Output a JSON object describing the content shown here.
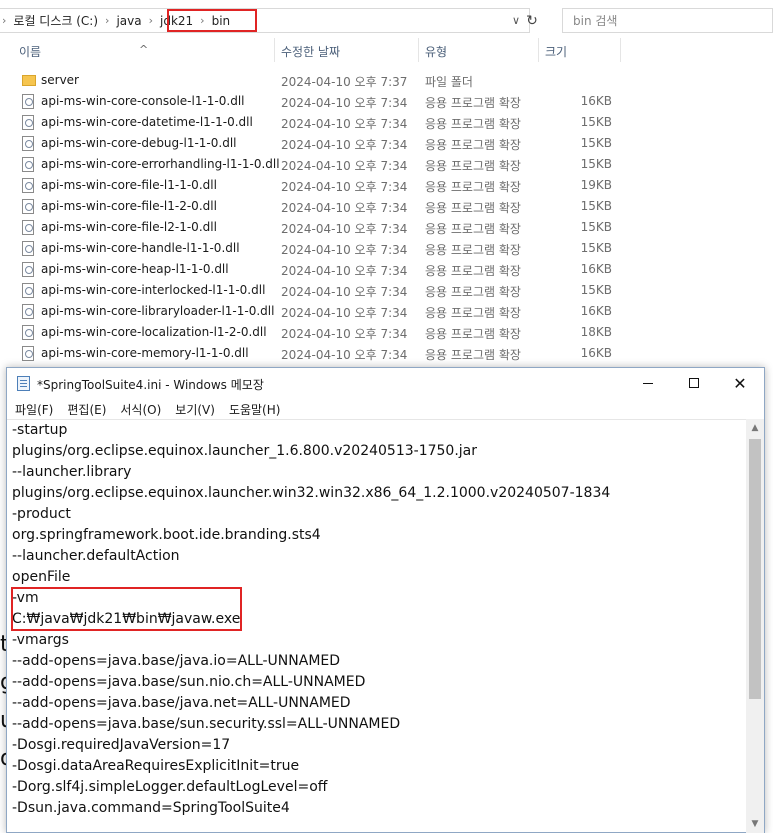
{
  "explorer": {
    "breadcrumb": [
      "로컬 디스크 (C:)",
      "java",
      "jdk21",
      "bin"
    ],
    "search_placeholder": "bin 검색",
    "columns": {
      "name": "이름",
      "modified": "수정한 날짜",
      "type": "유형",
      "size": "크기"
    },
    "rows": [
      {
        "kind": "folder",
        "name": "server",
        "modified": "2024-04-10 오후 7:37",
        "type": "파일 폴더",
        "size": ""
      },
      {
        "kind": "file",
        "name": "api-ms-win-core-console-l1-1-0.dll",
        "modified": "2024-04-10 오후 7:34",
        "type": "응용 프로그램 확장",
        "size": "16KB"
      },
      {
        "kind": "file",
        "name": "api-ms-win-core-datetime-l1-1-0.dll",
        "modified": "2024-04-10 오후 7:34",
        "type": "응용 프로그램 확장",
        "size": "15KB"
      },
      {
        "kind": "file",
        "name": "api-ms-win-core-debug-l1-1-0.dll",
        "modified": "2024-04-10 오후 7:34",
        "type": "응용 프로그램 확장",
        "size": "15KB"
      },
      {
        "kind": "file",
        "name": "api-ms-win-core-errorhandling-l1-1-0.dll",
        "modified": "2024-04-10 오후 7:34",
        "type": "응용 프로그램 확장",
        "size": "15KB"
      },
      {
        "kind": "file",
        "name": "api-ms-win-core-file-l1-1-0.dll",
        "modified": "2024-04-10 오후 7:34",
        "type": "응용 프로그램 확장",
        "size": "19KB"
      },
      {
        "kind": "file",
        "name": "api-ms-win-core-file-l1-2-0.dll",
        "modified": "2024-04-10 오후 7:34",
        "type": "응용 프로그램 확장",
        "size": "15KB"
      },
      {
        "kind": "file",
        "name": "api-ms-win-core-file-l2-1-0.dll",
        "modified": "2024-04-10 오후 7:34",
        "type": "응용 프로그램 확장",
        "size": "15KB"
      },
      {
        "kind": "file",
        "name": "api-ms-win-core-handle-l1-1-0.dll",
        "modified": "2024-04-10 오후 7:34",
        "type": "응용 프로그램 확장",
        "size": "15KB"
      },
      {
        "kind": "file",
        "name": "api-ms-win-core-heap-l1-1-0.dll",
        "modified": "2024-04-10 오후 7:34",
        "type": "응용 프로그램 확장",
        "size": "16KB"
      },
      {
        "kind": "file",
        "name": "api-ms-win-core-interlocked-l1-1-0.dll",
        "modified": "2024-04-10 오후 7:34",
        "type": "응용 프로그램 확장",
        "size": "15KB"
      },
      {
        "kind": "file",
        "name": "api-ms-win-core-libraryloader-l1-1-0.dll",
        "modified": "2024-04-10 오후 7:34",
        "type": "응용 프로그램 확장",
        "size": "16KB"
      },
      {
        "kind": "file",
        "name": "api-ms-win-core-localization-l1-2-0.dll",
        "modified": "2024-04-10 오후 7:34",
        "type": "응용 프로그램 확장",
        "size": "18KB"
      },
      {
        "kind": "file",
        "name": "api-ms-win-core-memory-l1-1-0.dll",
        "modified": "2024-04-10 오후 7:34",
        "type": "응용 프로그램 확장",
        "size": "16KB"
      }
    ]
  },
  "notepad": {
    "title": "*SpringToolSuite4.ini - Windows 메모장",
    "menu": [
      "파일(F)",
      "편집(E)",
      "서식(O)",
      "보기(V)",
      "도움말(H)"
    ],
    "lines": [
      "-startup",
      "plugins/org.eclipse.equinox.launcher_1.6.800.v20240513-1750.jar",
      "--launcher.library",
      "plugins/org.eclipse.equinox.launcher.win32.win32.x86_64_1.2.1000.v20240507-1834",
      "-product",
      "org.springframework.boot.ide.branding.sts4",
      "--launcher.defaultAction",
      "openFile",
      "-vm",
      "C:₩java₩jdk21₩bin₩javaw.exe",
      "-vmargs",
      "--add-opens=java.base/java.io=ALL-UNNAMED",
      "--add-opens=java.base/sun.nio.ch=ALL-UNNAMED",
      "--add-opens=java.base/java.net=ALL-UNNAMED",
      "--add-opens=java.base/sun.security.ssl=ALL-UNNAMED",
      "-Dosgi.requiredJavaVersion=17",
      "-Dosgi.dataAreaRequiresExplicitInit=true",
      "-Dorg.slf4j.simpleLogger.defaultLogLevel=off",
      "-Dsun.java.command=SpringToolSuite4"
    ]
  },
  "background_fragments": [
    "t",
    "g",
    "u",
    "o"
  ],
  "colors": {
    "highlight": "#e02424",
    "folder": "#f6c54f",
    "header_text": "#4c607a"
  }
}
